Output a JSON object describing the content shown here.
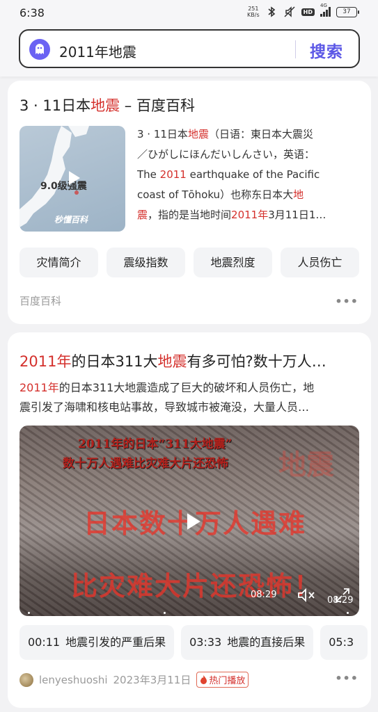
{
  "status_bar": {
    "time": "6:38",
    "net_speed_value": "251",
    "net_speed_unit": "KB/s",
    "hd": "HD",
    "network": "4G",
    "battery": "37"
  },
  "search": {
    "query": "2011年地震",
    "button_label": "搜索",
    "accent_color": "#5c58e6"
  },
  "result1": {
    "title_parts": [
      "3 · 11日本",
      "地震",
      " – 百度百科"
    ],
    "thumbnail": {
      "map_text": "9.0级强震",
      "brand": "秒懂百科"
    },
    "abstract_lines": [
      [
        "3 · 11日本",
        "地震",
        "（日语：東日本大震災"
      ],
      [
        "／ひがしにほんだいしんさい，英语："
      ],
      [
        "The ",
        "2011",
        " earthquake of the Pacific"
      ],
      [
        "coast of Tōhoku）也称东日本大",
        "地"
      ],
      [
        "震",
        "，指的是当地时间",
        "2011年",
        "3月11日1…"
      ]
    ],
    "chips": [
      "灾情简介",
      "震级指数",
      "地震烈度",
      "人员伤亡"
    ],
    "source": "百度百科",
    "more": "•••"
  },
  "result2": {
    "title_parts": [
      "2011年",
      "的日本311大",
      "地震",
      "有多可怕?数十万人…"
    ],
    "desc_lines": [
      [
        "2011年",
        "的日本311大地震造成了巨大的破坏和人员伤亡，地"
      ],
      [
        "震引发了海啸和核电站事故，导致城市被淹没，大量人员…"
      ]
    ],
    "video": {
      "caption_line1": "2011年的日本“311大地震”",
      "caption_line2": "数十万人遇难比灾难大片还恐怖",
      "big_text1": "日本数十万人遇难",
      "big_text2": "比灾难大片还恐怖！",
      "ghost_text": "地震",
      "current_time": "08:29",
      "duration": "08:29"
    },
    "chapters": [
      {
        "time": "00:11",
        "label": "地震引发的严重后果"
      },
      {
        "time": "03:33",
        "label": "地震的直接后果"
      },
      {
        "time": "05:3",
        "label": ""
      }
    ],
    "author": "lenyeshuoshi",
    "date": "2023年3月11日",
    "hot_label": "热门播放",
    "more": "•••"
  }
}
